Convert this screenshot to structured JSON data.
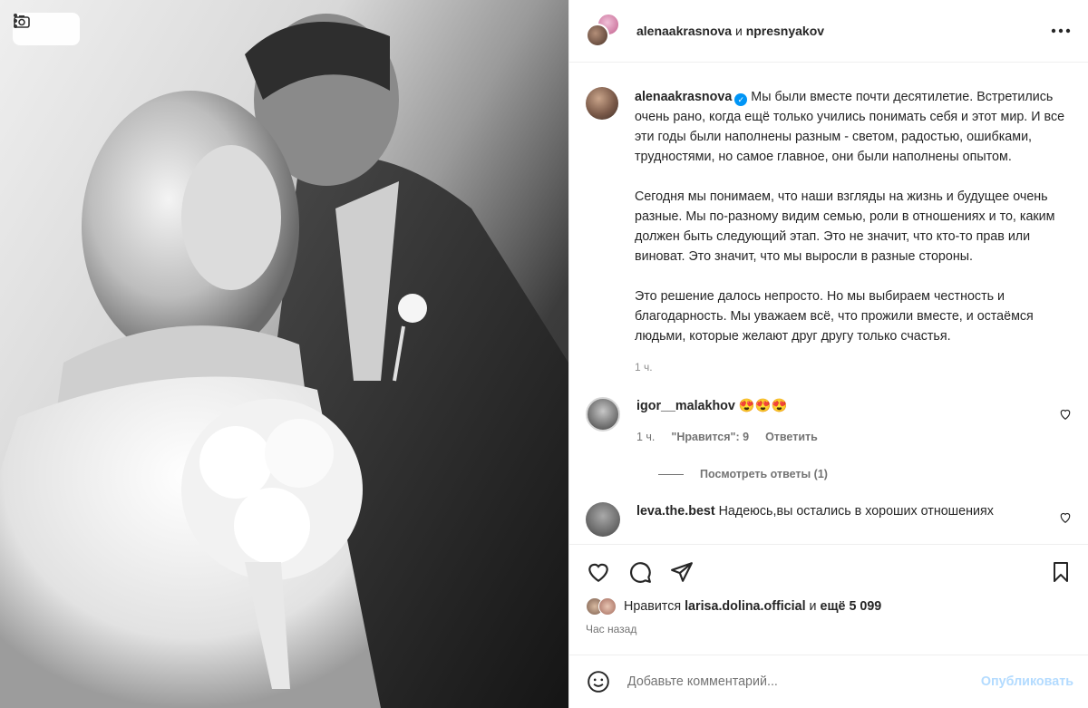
{
  "header": {
    "user1": "alenaakrasnova",
    "connector": "и",
    "user2": "npresnyakov",
    "more_icon": "ellipsis-icon"
  },
  "caption": {
    "username": "alenaakrasnova",
    "paragraphs": [
      "Мы были вместе почти десятилетие. Встретились очень рано, когда ещё только учились понимать себя и этот мир. И все эти годы были наполнены разным - светом, радостью, ошибками, трудностями, но самое главное, они были наполнены опытом.",
      "Сегодня мы понимаем, что наши взгляды на жизнь и будущее очень разные. Мы по-разному видим семью, роли в отношениях и то, каким должен быть следующий этап. Это не значит, что кто-то прав или виноват. Это значит, что мы выросли в разные стороны.",
      "Это решение далось непросто. Но мы выбираем честность и благодарность. Мы уважаем всё, что прожили вместе, и остаёмся людьми, которые желают друг другу только счастья."
    ],
    "time": "1 ч."
  },
  "comments": [
    {
      "username": "igor__malakhov",
      "text": "😍😍😍",
      "time": "1 ч.",
      "likes": "\"Нравится\": 9",
      "reply": "Ответить",
      "view_replies": "Посмотреть ответы (1)"
    },
    {
      "username": "leva.the.best",
      "text": "Надеюсь,вы остались в хороших отношениях"
    }
  ],
  "likes": {
    "prefix": "Нравится",
    "user": "larisa.dolina.official",
    "middle": "и",
    "more": "ещё 5 099"
  },
  "posted": "Час назад",
  "add_comment": {
    "placeholder": "Добавьте комментарий...",
    "publish": "Опубликовать"
  },
  "colors": {
    "accent": "#0095f6",
    "publish_disabled": "#b3dbff",
    "muted": "#737373"
  }
}
